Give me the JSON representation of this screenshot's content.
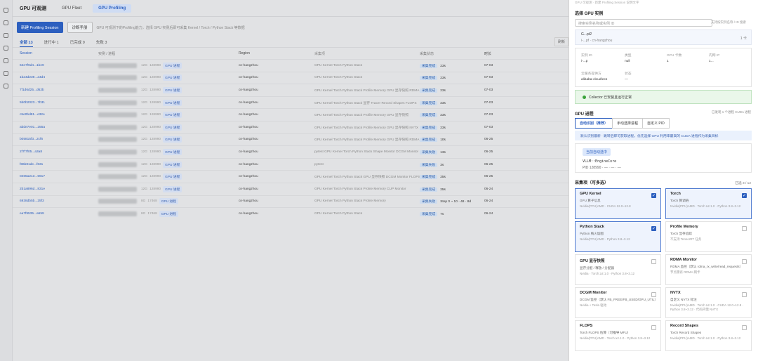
{
  "app": {
    "title": "GPU 可观测",
    "nav": [
      {
        "label": "GPU Fleet"
      },
      {
        "label": "GPU Profiling"
      }
    ]
  },
  "toolbar": {
    "create_label": "新建 Profiling Session",
    "guide_label": "诊断手册",
    "hint": "GPU 可观测下的Profiling能力，选择 GPU 实例后即可采集 Kernel / Torch / Python Stack 等数据"
  },
  "filters": [
    {
      "label": "全部 13"
    },
    {
      "label": "进行中 1"
    },
    {
      "label": "已完成 9"
    },
    {
      "label": "失败 3"
    }
  ],
  "table": {
    "columns": [
      "Session",
      "实例 / 进程",
      "Region",
      "采集项",
      "采集状态",
      "时长"
    ],
    "refresh": "刷新",
    "rows": [
      {
        "session": "62e7f9d4...1be9",
        "extra": "12G",
        "proc": "128990",
        "tag": "GPU 进程",
        "region": "cn-hangzhou",
        "collect": "GPU Kernel   Torch   Python Stack",
        "status": "采集完成",
        "dur": "23s",
        "time": "07-03"
      },
      {
        "session": "1ba4d239...a4d4",
        "extra": "12G",
        "proc": "128990",
        "tag": "GPU 进程",
        "region": "cn-hangzhou",
        "collect": "GPU Kernel   Torch   Python Stack",
        "status": "采集完成",
        "dur": "23s",
        "time": "07-03"
      },
      {
        "session": "7f1d6d25...d62b",
        "extra": "12G",
        "proc": "128990",
        "tag": "GPU 进程",
        "region": "cn-hangzhou",
        "collect": "GPU Kernel   Torch   Python Stack   Profile Memory   GPU 显存快照   RDMA Monit",
        "status": "采集完成",
        "dur": "23s",
        "time": "07-03"
      },
      {
        "session": "5b0b2023...7b31",
        "extra": "12G",
        "proc": "128990",
        "tag": "GPU 进程",
        "region": "cn-hangzhou",
        "collect": "GPU Kernel   Torch   Python Stack   显存 Tracer   Record Shapes   FLOPS",
        "status": "采集完成",
        "dur": "23s",
        "time": "07-03"
      },
      {
        "session": "c5e0bd81...e32e",
        "extra": "12G",
        "proc": "128990",
        "tag": "GPU 进程",
        "region": "cn-hangzhou",
        "collect": "GPU Kernel   Torch   Python Stack   Profile Memory   GPU 显存快照",
        "status": "采集完成",
        "dur": "23s",
        "time": "07-03"
      },
      {
        "session": "abde7e01...255a",
        "extra": "12G",
        "proc": "128990",
        "tag": "GPU 进程",
        "region": "cn-hangzhou",
        "collect": "GPU Kernel   Torch   Python Stack   Profile Memory   GPU 显存快照   NVTX",
        "status": "采集完成",
        "dur": "23s",
        "time": "07-03"
      },
      {
        "session": "b05815f3...2cf6",
        "extra": "12G",
        "proc": "128990",
        "tag": "GPU 进程",
        "region": "cn-hangzhou",
        "collect": "GPU Kernel   Torch   Python Stack   Profile Memory   GPU 显存快照   RDMA Monit",
        "status": "采集完成",
        "dur": "10s",
        "time": "06-25"
      },
      {
        "session": "2f7f7f05...a3a8",
        "extra": "12G",
        "proc": "128990",
        "tag": "GPU 进程",
        "region": "cn-hangzhou",
        "collect": "pytest   GPU Kernel   Torch   Python Stack   Shape Monitor   DCGM Monitor",
        "status": "采集失败",
        "dur": "13s",
        "time": "06-25"
      },
      {
        "session": "f86b81de...f831",
        "extra": "12G",
        "proc": "128990",
        "tag": "GPU 进程",
        "region": "cn-hangzhou",
        "collect": "pytest",
        "status": "采集失败",
        "dur": "3s",
        "time": "06-25"
      },
      {
        "session": "0465a213...5917",
        "extra": "12G",
        "proc": "128990",
        "tag": "GPU 进程",
        "region": "cn-hangzhou",
        "collect": "GPU Kernel   Torch   Python Stack   GPU 显存快照   DCGM Monitor   FLOPS",
        "status": "采集完成",
        "dur": "25s",
        "time": "06-25"
      },
      {
        "session": "2b1a896d...831e",
        "extra": "12G",
        "proc": "128990",
        "tag": "GPU 进程",
        "region": "cn-hangzhou",
        "collect": "GPU Kernel   Torch   Python Stack   Profile Memory   CUP Monitor",
        "status": "采集完成",
        "dur": "25s",
        "time": "06-24"
      },
      {
        "session": "6938db5b...25f3",
        "extra": "8G",
        "proc": "17468",
        "tag": "GPU 进程",
        "region": "cn-hangzhou",
        "collect": "GPU Kernel   Torch   Python Stack   Profile Memory",
        "status": "采集失败",
        "dur": "Step 0 ~ 10 · 48 · 8d",
        "time": "06-24"
      },
      {
        "session": "ea7f9535...a559",
        "extra": "8G",
        "proc": "17468",
        "tag": "GPU 进程",
        "region": "cn-hangzhou",
        "collect": "GPU Kernel   Torch   Python Stack",
        "status": "采集完成",
        "dur": "7s",
        "time": "06-24"
      }
    ]
  },
  "panel": {
    "top_note": "GPU 可观测 · 新建 Profiling Session 说明文字",
    "select_title": "选择 GPU 实例",
    "search_placeholder": "搜索实例名称或实例 ID",
    "search_note": "支持按实例名称 / ID 搜索",
    "instance_name": "G...pt2",
    "instance_sub": "i-...pf · cn-hangzhou",
    "instance_count": "1 卡",
    "info": {
      "id_label": "实例 ID",
      "id_val": "i-...p",
      "type_label": "类型",
      "type_val": "null",
      "gpu_label": "GPU 卡数",
      "gpu_val": "1",
      "ip_label": "内网 IP",
      "ip_val": "1...",
      "provider_label": "云服务提供方",
      "provider_val": "alibaba-cloud/ecs",
      "state_label": "状态",
      "state_val": "—"
    },
    "collector": "Collector 已安装且运行正常",
    "proc_title": "GPU 进程",
    "proc_note": "已发现 1 个进程 CUDA 进程",
    "proc_tabs": [
      "自动识别（推荐）",
      "手动选择进程",
      "自定义 PID"
    ],
    "proc_hint": "默认识别最新 · 跳转后即可获取进程，优先选择 GPU 利用率最高的 CUDA 进程作为采集目标",
    "current_label": "当前自动选中",
    "current_proc": "VLLM::EngineCore",
    "current_pid": "PID 128990 · — · — · —",
    "collect_title": "采集项（可多选）",
    "collect_count": "已选 3 / 12",
    "items": [
      {
        "name": "GPU Kernel",
        "desc": "GPU 算子信息",
        "env": "Nvidia(PPU)AMD · CUDA 12.0~12.8",
        "on": true
      },
      {
        "name": "Torch",
        "desc": "Torch 算调链",
        "env": "Nvidia(PPU)AMD · Torch ≥2.1.0 · Python 3.8~3.12",
        "on": true
      },
      {
        "name": "Python Stack",
        "desc": "Python 栈火焰图",
        "env": "Nvidia(PPU)AMD · Python 3.8~3.12",
        "on": true
      },
      {
        "name": "Profile Memory",
        "desc": "Torch 显存追踪",
        "env": "不支持 TensorRT 任务",
        "on": false
      },
      {
        "name": "GPU 显存快照",
        "desc": "显存分配 / 释放 / 分配器",
        "env": "Nvidia · Torch ≥2.1.0 · Python 3.8~3.12",
        "on": false
      },
      {
        "name": "RDMA Monitor",
        "desc": "RDMA 监控（默认 rdma_rx_write/read_requests）",
        "env": "节点需有 RDMA 网卡",
        "on": false
      },
      {
        "name": "DCGM Monitor",
        "desc": "DCGM 监控（默认 FB_FREE/FB_USED/GPU_UTIL）",
        "env": "Nvidia + Tesla 驱动",
        "on": false
      },
      {
        "name": "NVTX",
        "desc": "自定义 NVTX 标注",
        "env": "Nvidia(PPU)AMD · Torch ≥2.1.0 · CUDA 12.0~12.8 · Python 3.8~3.12 · 代码内需 NVTX",
        "on": false
      },
      {
        "name": "FLOPS",
        "desc": "Torch FLOPS 估算（可推导 MFU）",
        "env": "Nvidia(PPU)AMD · Torch ≥2.1.0 · Python 3.8~3.12",
        "on": false
      },
      {
        "name": "Record Shapes",
        "desc": "Torch Record Shapes",
        "env": "Nvidia(PPU)AMD · Torch ≥2.1.0 · Python 3.8~3.12",
        "on": false
      }
    ]
  }
}
